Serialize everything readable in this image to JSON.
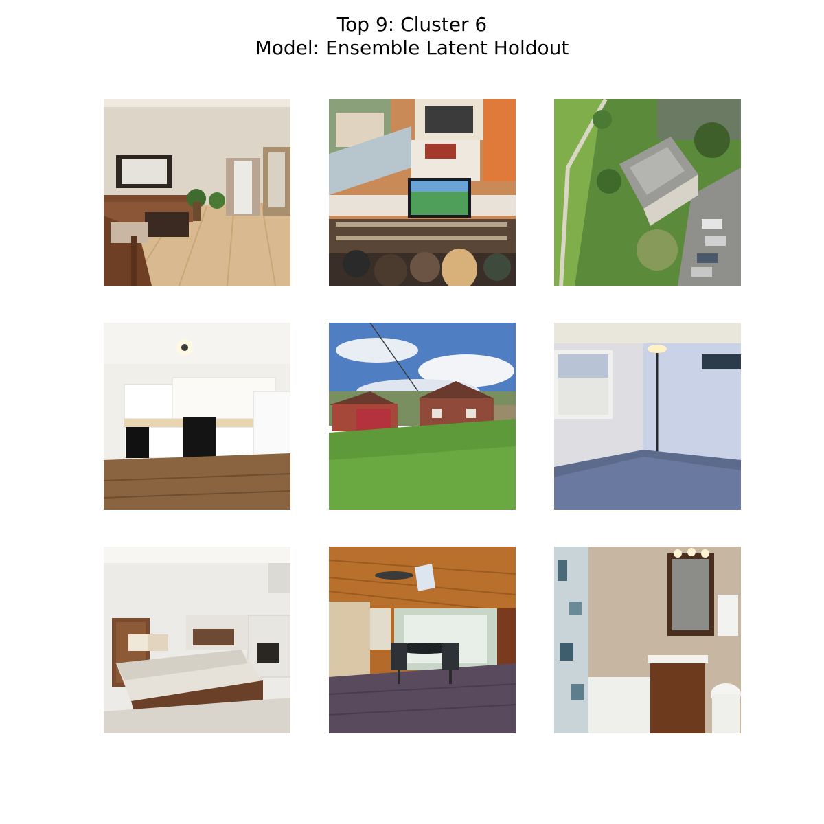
{
  "figure": {
    "title_line1": "Top 9: Cluster 6",
    "title_line2": "Model: Ensemble Latent Holdout"
  },
  "grid": {
    "rows": 3,
    "columns": 3,
    "images": [
      {
        "subject": "living room with sofa, armchair and hardwood floor"
      },
      {
        "subject": "bar interior with mural and television"
      },
      {
        "subject": "aerial view of building, trees and parking lot"
      },
      {
        "subject": "white kitchen with wood floor"
      },
      {
        "subject": "backyard lawn with brick houses under cloudy sky"
      },
      {
        "subject": "empty bedroom with blue carpet, window and floor lamp"
      },
      {
        "subject": "bedroom with wooden bed and fireplace"
      },
      {
        "subject": "covered wooden porch with patio table and chairs"
      },
      {
        "subject": "bathroom with tub, shower curtain, vanity and mirror"
      }
    ]
  }
}
